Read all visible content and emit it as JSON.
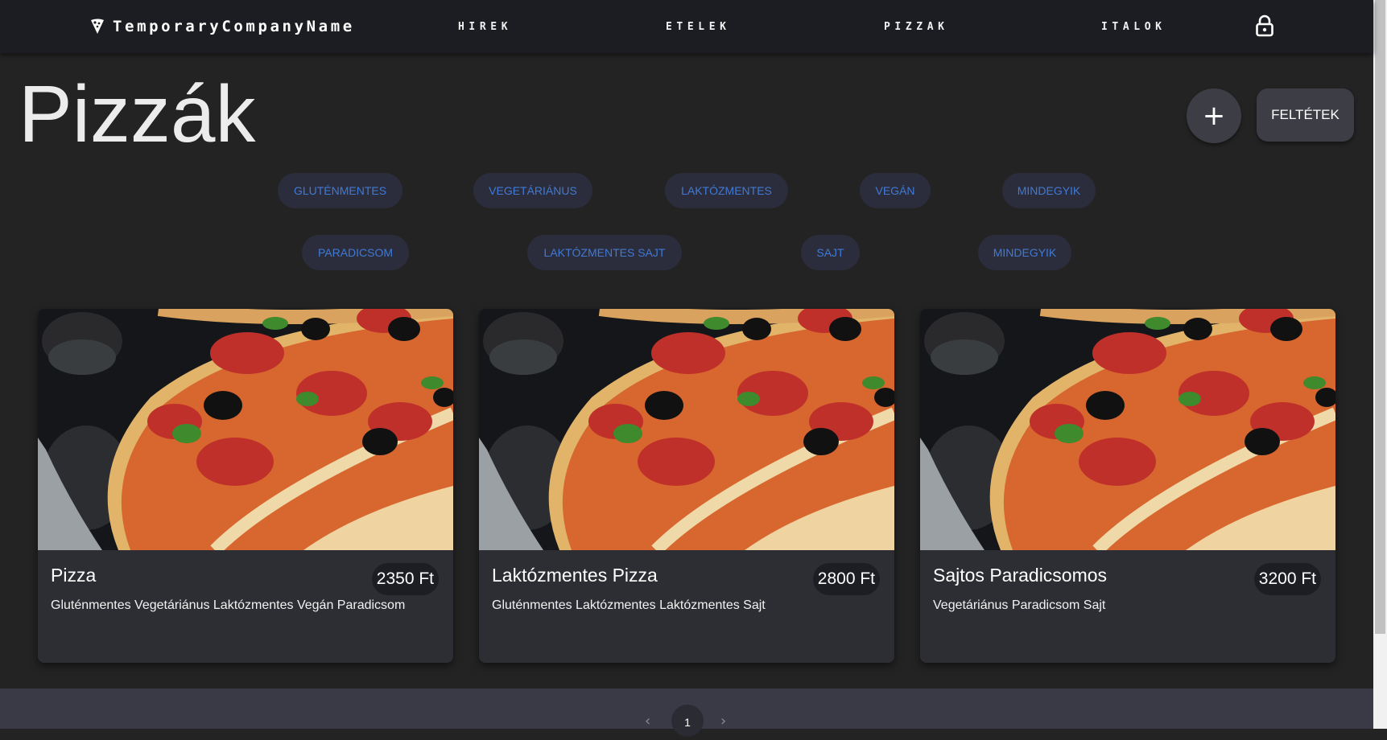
{
  "brand": {
    "name": "TemporaryCompanyName",
    "icon": "pizza-slice-icon"
  },
  "nav": {
    "items": [
      {
        "label": "HIREK"
      },
      {
        "label": "ETELEK"
      },
      {
        "label": "PIZZAK"
      },
      {
        "label": "ITALOK"
      }
    ],
    "lock_icon": "lock-icon"
  },
  "page": {
    "title": "Pizzák",
    "add_button": "+",
    "conditions_button": "FELTÉTEK"
  },
  "filters": {
    "row1": [
      "GLUTÉNMENTES",
      "VEGETÁRIÁNUS",
      "LAKTÓZMENTES",
      "VEGÁN",
      "MINDEGYIK"
    ],
    "row2": [
      "PARADICSOM",
      "LAKTÓZMENTES SAJT",
      "SAJT",
      "MINDEGYIK"
    ],
    "chip_text_color": "#3f7ad4"
  },
  "cards": [
    {
      "title": "Pizza",
      "price": "2350 Ft",
      "tags": "Gluténmentes Vegetáriánus Laktózmentes Vegán Paradicsom"
    },
    {
      "title": "Laktózmentes Pizza",
      "price": "2800 Ft",
      "tags": "Gluténmentes Laktózmentes Laktózmentes Sajt"
    },
    {
      "title": "Sajtos Paradicsomos",
      "price": "3200 Ft",
      "tags": "Vegetáriánus Paradicsom Sajt"
    }
  ],
  "pagination": {
    "prev": "‹",
    "current": "1",
    "next": "›"
  },
  "colors": {
    "background": "#232323",
    "navbar": "#1c1d22",
    "card": "#2d2e34",
    "chip": "#2c2d3c",
    "footer": "#393a45"
  }
}
